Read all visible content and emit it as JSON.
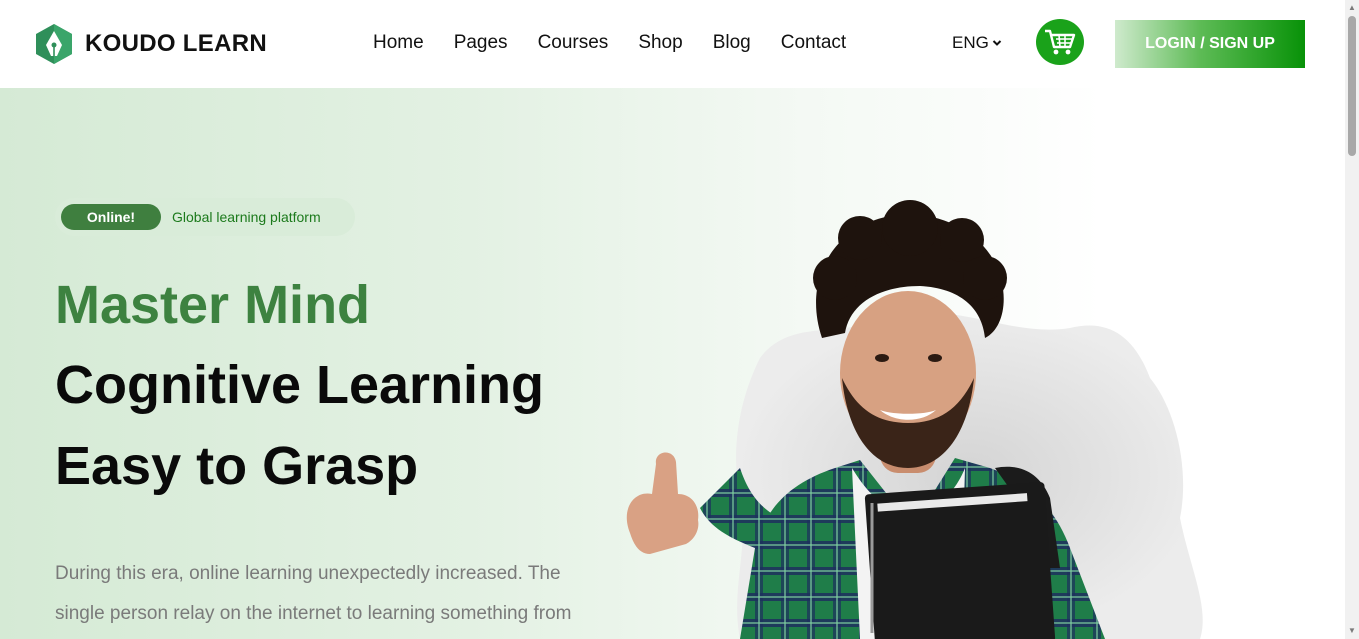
{
  "brand": {
    "name": "KOUDO LEARN",
    "logo_icon": "pen-nib-icon",
    "color": "#2f8f5a"
  },
  "nav": {
    "items": [
      {
        "label": "Home"
      },
      {
        "label": "Pages"
      },
      {
        "label": "Courses"
      },
      {
        "label": "Shop"
      },
      {
        "label": "Blog"
      },
      {
        "label": "Contact"
      }
    ]
  },
  "language": {
    "selected": "ENG",
    "icon": "chevron-down-icon"
  },
  "cart": {
    "icon": "shopping-cart-icon",
    "color": "#1aa21a"
  },
  "auth": {
    "login_label": "LOGIN / SIGN UP",
    "accent": "#089208"
  },
  "hero": {
    "badge_pill": "Online!",
    "badge_text": "Global learning platform",
    "headline_green": "Master Mind",
    "headline_line2": "Cognitive Learning",
    "headline_line3": "Easy to Grasp",
    "description": "During this era, online learning unexpectedly increased. The single person relay on the internet to learning something from",
    "accent_color": "#3d8240"
  }
}
